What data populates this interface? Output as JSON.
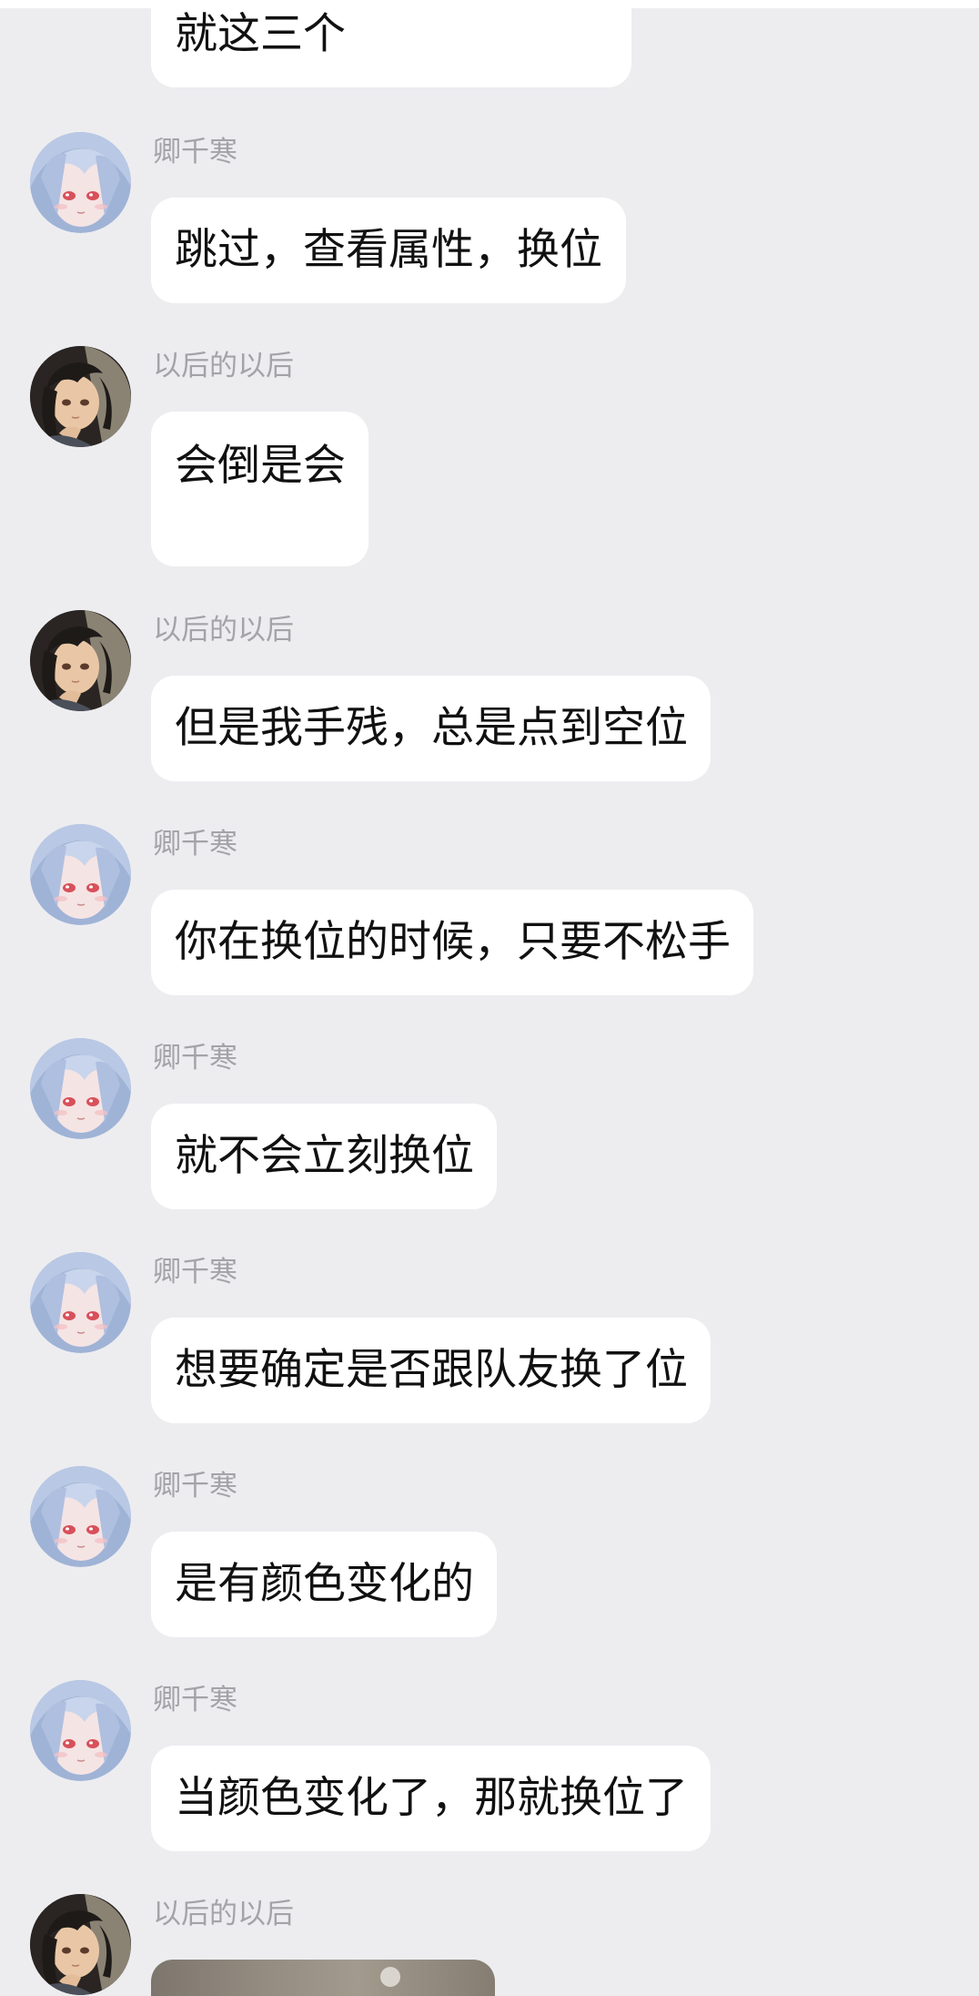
{
  "senders": {
    "qing": "卿千寒",
    "yihou": "以后的以后"
  },
  "icons": {
    "qing_avatar": "anime-girl-silver-hair-avatar-icon",
    "yihou_avatar": "anime-girl-dark-hair-avatar-icon"
  },
  "colors": {
    "background": "#ededf0",
    "bubble": "#ffffff",
    "sender_name": "#a3a3a8",
    "message_text": "#111111"
  },
  "messages": [
    {
      "sender": "",
      "text": "就这三个"
    },
    {
      "sender": "卿千寒",
      "text": "跳过，查看属性，换位"
    },
    {
      "sender": "以后的以后",
      "text": "会倒是会"
    },
    {
      "sender": "以后的以后",
      "text": "但是我手残，总是点到空位"
    },
    {
      "sender": "卿千寒",
      "text": "你在换位的时候，只要不松手"
    },
    {
      "sender": "卿千寒",
      "text": "就不会立刻换位"
    },
    {
      "sender": "卿千寒",
      "text": "想要确定是否跟队友换了位"
    },
    {
      "sender": "卿千寒",
      "text": "是有颜色变化的"
    },
    {
      "sender": "卿千寒",
      "text": "当颜色变化了，那就换位了"
    },
    {
      "sender": "以后的以后",
      "text": ""
    }
  ]
}
